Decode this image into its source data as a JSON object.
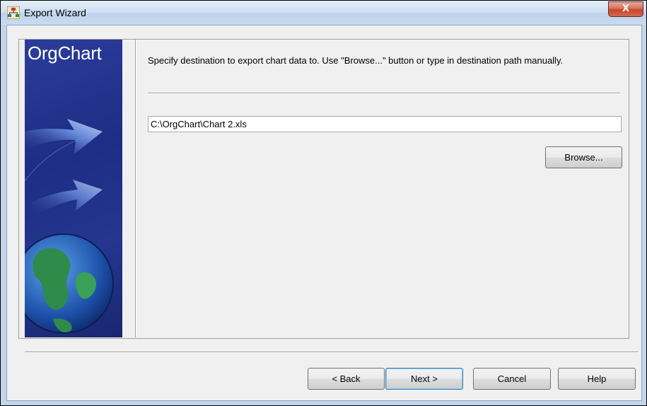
{
  "window": {
    "title": "Export Wizard",
    "close_glyph": "X"
  },
  "sidebar": {
    "brand": "OrgChart"
  },
  "main": {
    "instruction": "Specify destination to export chart data to. Use \"Browse...\" button or type in destination path manually.",
    "path_value": "C:\\OrgChart\\Chart 2.xls",
    "browse_label": "Browse..."
  },
  "footer": {
    "back_label": "< Back",
    "next_label": "Next >",
    "cancel_label": "Cancel",
    "help_label": "Help"
  },
  "icons": {
    "app": "app-icon",
    "close": "close-icon",
    "arrow": "arrow-icon",
    "globe": "globe-icon"
  }
}
